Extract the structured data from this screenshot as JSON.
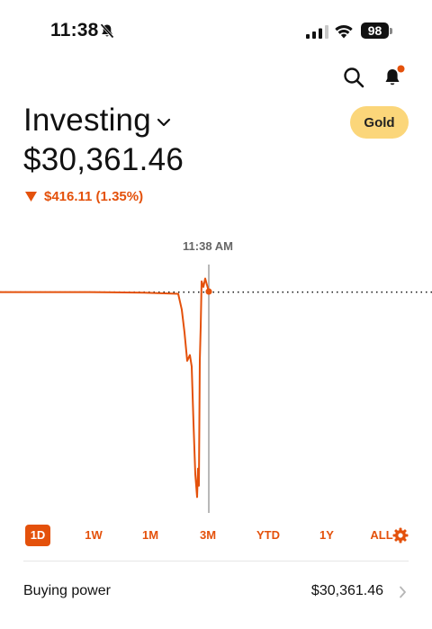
{
  "status": {
    "time": "11:38",
    "battery": "98"
  },
  "header": {
    "title": "Investing",
    "gold_label": "Gold",
    "portfolio_value": "$30,361.46",
    "change_text": "$416.11 (1.35%)",
    "change_direction": "down"
  },
  "chart": {
    "time_label": "11:38 AM",
    "line_color": "#e4510b"
  },
  "chart_data": {
    "type": "line",
    "title": "",
    "xlabel": "",
    "ylabel": "",
    "series": [
      {
        "name": "",
        "values": [
          30361,
          30361,
          30361,
          30360,
          30358,
          30330,
          30290,
          30240,
          30250,
          30230,
          30130,
          30040,
          30000,
          30050,
          30020,
          30240,
          30300,
          30380,
          30370,
          30385,
          30362
        ]
      }
    ],
    "reference_line": 30361,
    "ylim": [
      29980,
      30400
    ],
    "grid": false
  },
  "ranges": {
    "items": [
      "1D",
      "1W",
      "1M",
      "3M",
      "YTD",
      "1Y",
      "ALL"
    ],
    "active": "1D"
  },
  "buying_power": {
    "label": "Buying power",
    "value": "$30,361.46"
  },
  "colors": {
    "accent": "#e4510b",
    "gold": "#fbd67a"
  }
}
